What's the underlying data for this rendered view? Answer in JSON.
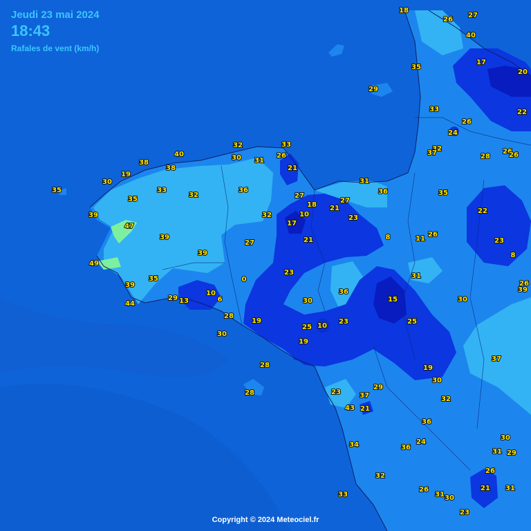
{
  "header": {
    "date": "Jeudi 23 mai 2024",
    "time": "18:43",
    "subtitle": "Rafales de vent (km/h)"
  },
  "copyright": "Copyright © 2024 Meteociel.fr",
  "colors": {
    "sea": "#0f63d8",
    "band_light": "#33b3f3",
    "band_mid": "#1c86ee",
    "band_dark": "#0b36e0",
    "band_darkest": "#081cc0",
    "band_green": "#7df0a0",
    "label_text": "#ffe600",
    "header_text": "#39c6ff"
  },
  "stations": [
    {
      "v": "18"
    },
    {
      "v": "26"
    },
    {
      "v": "27"
    },
    {
      "v": "40"
    },
    {
      "v": "35"
    },
    {
      "v": "29"
    },
    {
      "v": "17"
    },
    {
      "v": "20"
    },
    {
      "v": "33"
    },
    {
      "v": "22"
    },
    {
      "v": "24"
    },
    {
      "v": "26"
    },
    {
      "v": "32"
    },
    {
      "v": "37"
    },
    {
      "v": "26"
    },
    {
      "v": "28"
    },
    {
      "v": "26"
    },
    {
      "v": "33"
    },
    {
      "v": "32"
    },
    {
      "v": "30"
    },
    {
      "v": "31"
    },
    {
      "v": "26"
    },
    {
      "v": "21"
    },
    {
      "v": "40"
    },
    {
      "v": "38"
    },
    {
      "v": "38"
    },
    {
      "v": "19"
    },
    {
      "v": "30"
    },
    {
      "v": "35"
    },
    {
      "v": "33"
    },
    {
      "v": "32"
    },
    {
      "v": "36"
    },
    {
      "v": "27"
    },
    {
      "v": "31"
    },
    {
      "v": "36"
    },
    {
      "v": "35"
    },
    {
      "v": "18"
    },
    {
      "v": "21"
    },
    {
      "v": "27"
    },
    {
      "v": "23"
    },
    {
      "v": "22"
    },
    {
      "v": "35"
    },
    {
      "v": "39"
    },
    {
      "v": "47"
    },
    {
      "v": "39"
    },
    {
      "v": "32"
    },
    {
      "v": "17"
    },
    {
      "v": "10"
    },
    {
      "v": "21"
    },
    {
      "v": "27"
    },
    {
      "v": "8"
    },
    {
      "v": "11"
    },
    {
      "v": "26"
    },
    {
      "v": "23"
    },
    {
      "v": "8"
    },
    {
      "v": "49"
    },
    {
      "v": "39"
    },
    {
      "v": "23"
    },
    {
      "v": "0"
    },
    {
      "v": "36"
    },
    {
      "v": "31"
    },
    {
      "v": "26"
    },
    {
      "v": "39"
    },
    {
      "v": "35"
    },
    {
      "v": "39"
    },
    {
      "v": "44"
    },
    {
      "v": "29"
    },
    {
      "v": "13"
    },
    {
      "v": "10"
    },
    {
      "v": "6"
    },
    {
      "v": "30"
    },
    {
      "v": "15"
    },
    {
      "v": "30"
    },
    {
      "v": "28"
    },
    {
      "v": "19"
    },
    {
      "v": "25"
    },
    {
      "v": "10"
    },
    {
      "v": "23"
    },
    {
      "v": "25"
    },
    {
      "v": "30"
    },
    {
      "v": "19"
    },
    {
      "v": "28"
    },
    {
      "v": "37"
    },
    {
      "v": "19"
    },
    {
      "v": "30"
    },
    {
      "v": "29"
    },
    {
      "v": "23"
    },
    {
      "v": "37"
    },
    {
      "v": "32"
    },
    {
      "v": "28"
    },
    {
      "v": "43"
    },
    {
      "v": "21"
    },
    {
      "v": "36"
    },
    {
      "v": "24"
    },
    {
      "v": "36"
    },
    {
      "v": "34"
    },
    {
      "v": "30"
    },
    {
      "v": "31"
    },
    {
      "v": "29"
    },
    {
      "v": "32"
    },
    {
      "v": "26"
    },
    {
      "v": "33"
    },
    {
      "v": "26"
    },
    {
      "v": "31"
    },
    {
      "v": "30"
    },
    {
      "v": "21"
    },
    {
      "v": "31"
    },
    {
      "v": "23"
    }
  ]
}
